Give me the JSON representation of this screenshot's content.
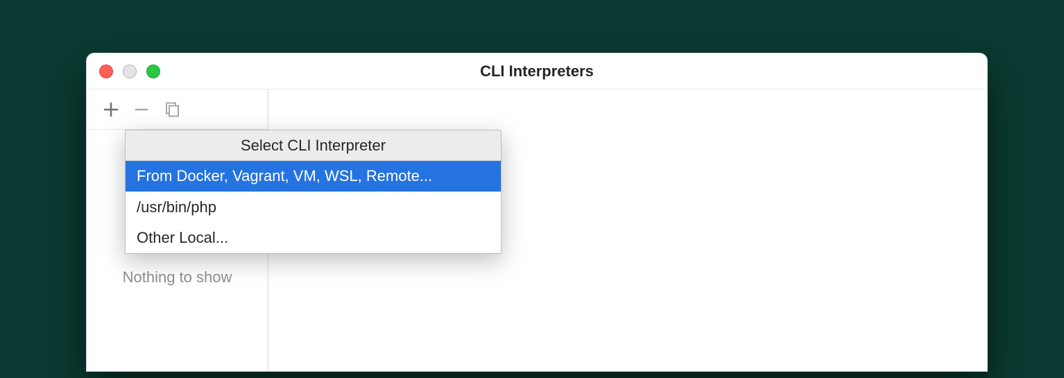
{
  "window": {
    "title": "CLI Interpreters"
  },
  "sidebar": {
    "placeholder": "Nothing to show"
  },
  "popup": {
    "title": "Select CLI Interpreter",
    "items": [
      {
        "label": "From Docker, Vagrant, VM, WSL, Remote...",
        "selected": true
      },
      {
        "label": "/usr/bin/php",
        "selected": false
      },
      {
        "label": "Other Local...",
        "selected": false
      }
    ]
  },
  "colors": {
    "selection": "#2473e0"
  }
}
